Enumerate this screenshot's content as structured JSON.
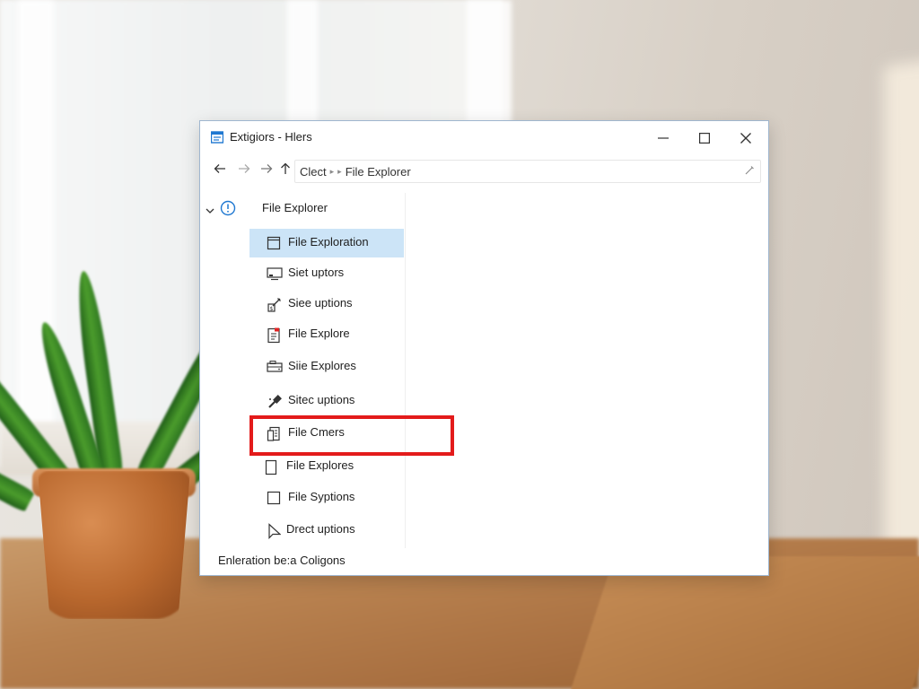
{
  "window": {
    "title": "Extigiors - Hlers",
    "minimize_icon": "minimize-icon",
    "maximize_icon": "maximize-icon",
    "close_icon": "close-icon"
  },
  "address": {
    "back_icon": "arrow-left-icon",
    "forward_icon": "arrow-right-icon",
    "up_icon": "arrow-up-icon",
    "crumbs": [
      "Clect",
      "File Explorer"
    ],
    "edit_icon": "pencil-icon"
  },
  "navigation": {
    "root_label": "File Explorer",
    "items": [
      {
        "label": "File Exploration",
        "icon": "window-icon",
        "selected": true
      },
      {
        "label": "Siet uptors",
        "icon": "monitor-icon",
        "selected": false
      },
      {
        "label": "Siee uptions",
        "icon": "pen-tool-icon",
        "selected": false
      },
      {
        "label": "File Explore",
        "icon": "document-icon",
        "selected": false
      },
      {
        "label": "Siie Explores",
        "icon": "drive-icon",
        "selected": false
      },
      {
        "label": "Sitec uptions",
        "icon": "usb-icon",
        "selected": false
      },
      {
        "label": "File Cmers",
        "icon": "files-icon",
        "selected": false
      },
      {
        "label": "File Explores",
        "icon": "page-icon",
        "selected": false
      },
      {
        "label": "File Syptions",
        "icon": "square-icon",
        "selected": false
      },
      {
        "label": "Drect uptions",
        "icon": "cursor-icon",
        "selected": false
      }
    ]
  },
  "status": {
    "text": "Enleration be:a Coligons"
  },
  "colors": {
    "accent_blue": "#1f78d1",
    "selection": "#cce4f7",
    "highlight_red": "#e31b1b"
  }
}
